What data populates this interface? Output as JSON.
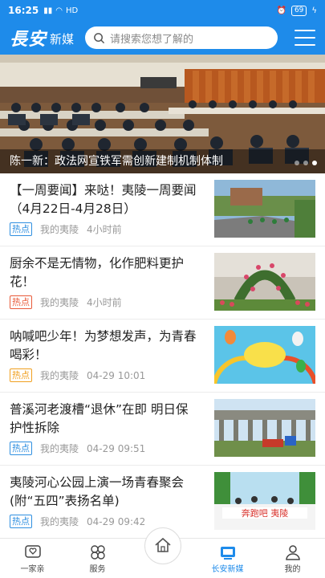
{
  "status": {
    "time": "16:25",
    "network": "HD",
    "battery": "69"
  },
  "app": {
    "logo": "長安",
    "logo_sub": "新媒"
  },
  "search": {
    "placeholder": "请搜索您想了解的"
  },
  "banner": {
    "caption": "陈一新：政法网宣铁军需创新建制机制体制"
  },
  "news": [
    {
      "title": "【一周要闻】来哒！夷陵一周要闻（4月22日-4月28日）",
      "tag": "热点",
      "tag_color": "#2f8fe0",
      "source": "我的夷陵",
      "time": "4小时前"
    },
    {
      "title": "厨余不是无情物，化作肥料更护花！",
      "tag": "热点",
      "tag_color": "#e85a3a",
      "source": "我的夷陵",
      "time": "4小时前"
    },
    {
      "title": "呐喊吧少年！为梦想发声，为青春喝彩！",
      "tag": "热点",
      "tag_color": "#f0a020",
      "source": "我的夷陵",
      "time": "04-29 10:01"
    },
    {
      "title": "普溪河老渡槽“退休”在即 明日保护性拆除",
      "tag": "热点",
      "tag_color": "#2f8fe0",
      "source": "我的夷陵",
      "time": "04-29 09:51"
    },
    {
      "title": "夷陵河心公园上演一场青春聚会(附“五四”表扬名单)",
      "tag": "热点",
      "tag_color": "#2f8fe0",
      "source": "我的夷陵",
      "time": "04-29 09:42"
    }
  ],
  "tabs": [
    {
      "label": "一家亲"
    },
    {
      "label": "服务"
    },
    {
      "label": ""
    },
    {
      "label": "长安新媒"
    },
    {
      "label": "我的"
    }
  ],
  "colors": {
    "brand": "#1e8bea"
  }
}
